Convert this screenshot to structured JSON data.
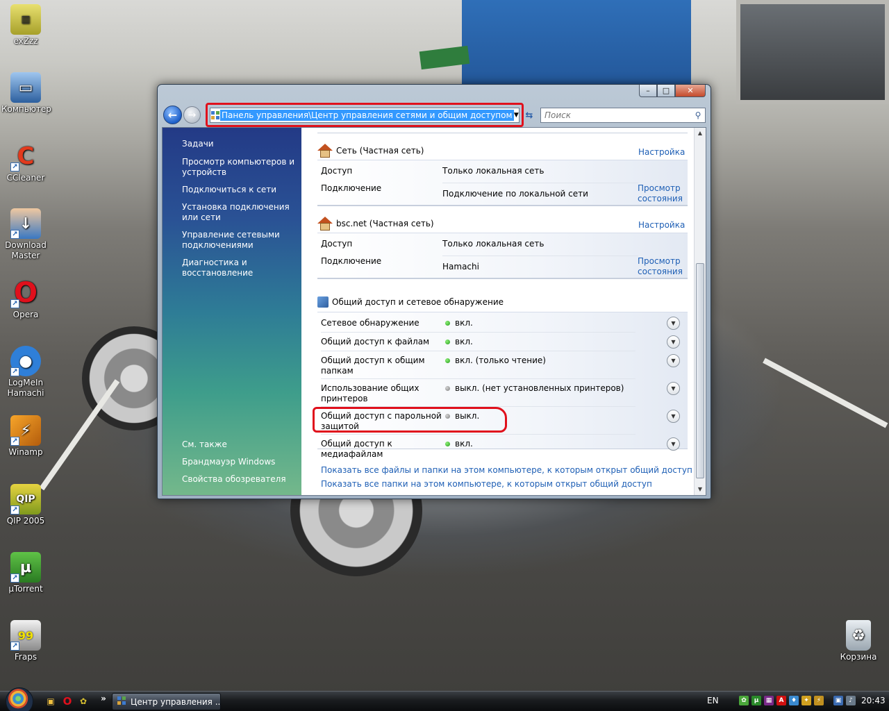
{
  "desktop": {
    "icons": [
      {
        "label": "exZzz",
        "icon": "folder-archive-icon"
      },
      {
        "label": "Компьютер",
        "icon": "computer-icon"
      },
      {
        "label": "CCleaner",
        "icon": "ccleaner-icon"
      },
      {
        "label": "Download Master",
        "icon": "download-master-icon"
      },
      {
        "label": "Opera",
        "icon": "opera-icon"
      },
      {
        "label": "LogMeIn Hamachi",
        "icon": "hamachi-icon"
      },
      {
        "label": "Winamp",
        "icon": "winamp-icon"
      },
      {
        "label": "QIP 2005",
        "icon": "qip-icon"
      },
      {
        "label": "µTorrent",
        "icon": "utorrent-icon"
      },
      {
        "label": "Fraps",
        "icon": "fraps-icon"
      }
    ],
    "recycle_bin": {
      "label": "Корзина",
      "icon": "recycle-bin-icon"
    }
  },
  "window": {
    "controls": {
      "minimize": "–",
      "maximize": "□",
      "close": "✕"
    },
    "address": "Панель управления\\Центр управления сетями и общим доступом",
    "search_placeholder": "Поиск",
    "sidebar": {
      "tasks_title": "Задачи",
      "tasks": [
        "Просмотр компьютеров и устройств",
        "Подключиться к сети",
        "Установка подключения или сети",
        "Управление сетевыми подключениями",
        "Диагностика и восстановление"
      ],
      "see_also_title": "См. также",
      "see_also": [
        "Брандмауэр Windows",
        "Свойства обозревателя"
      ]
    },
    "networks": [
      {
        "name": "Сеть (Частная сеть)",
        "customize": "Настройка",
        "access_label": "Доступ",
        "access_value": "Только локальная сеть",
        "connection_label": "Подключение",
        "connection_value": "Подключение по локальной сети",
        "view_status": "Просмотр состояния"
      },
      {
        "name": "bsc.net (Частная сеть)",
        "customize": "Настройка",
        "access_label": "Доступ",
        "access_value": "Только локальная сеть",
        "connection_label": "Подключение",
        "connection_value": "Hamachi",
        "view_status": "Просмотр состояния"
      }
    ],
    "sharing": {
      "title": "Общий доступ и сетевое обнаружение",
      "rows": [
        {
          "label": "Сетевое обнаружение",
          "status": "вкл.",
          "on": true
        },
        {
          "label": "Общий доступ к файлам",
          "status": "вкл.",
          "on": true
        },
        {
          "label": "Общий доступ к общим папкам",
          "status": "вкл. (только чтение)",
          "on": true
        },
        {
          "label": "Использование общих принтеров",
          "status": "выкл. (нет установленных принтеров)",
          "on": false
        },
        {
          "label": "Общий доступ с парольной защитой",
          "status": "выкл.",
          "on": false
        },
        {
          "label": "Общий доступ к медиафайлам",
          "status": "вкл.",
          "on": true
        }
      ]
    },
    "footer_links": [
      "Показать все файлы и папки на этом компьютере, к которым открыт общий доступ",
      "Показать все папки на этом компьютере, к которым открыт общий доступ"
    ]
  },
  "taskbar": {
    "active_task": "Центр управления ...",
    "language": "EN",
    "clock": "20:43",
    "show_more": "»"
  },
  "colors": {
    "highlight_red": "#e0101c",
    "link_blue": "#1e5fb5",
    "status_on": "#229a16",
    "status_off": "#7d7d7d"
  }
}
